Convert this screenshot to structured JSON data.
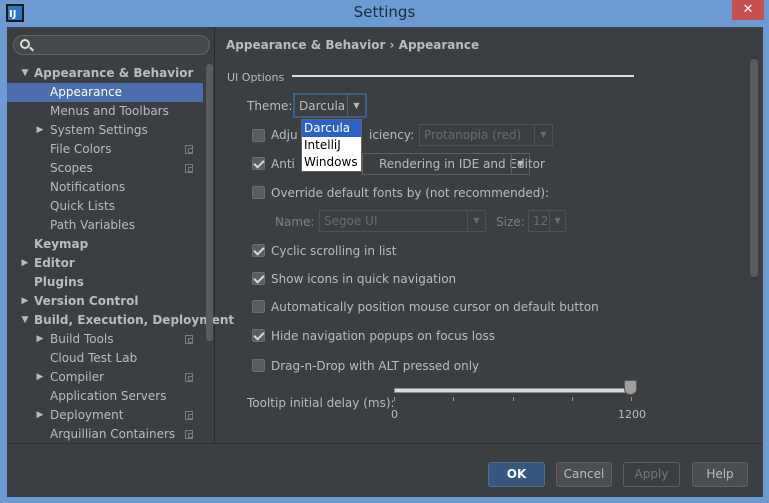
{
  "window": {
    "title": "Settings",
    "close_glyph": "✕",
    "app_icon": "intellij-icon"
  },
  "search": {
    "placeholder": ""
  },
  "sidebar": {
    "items": [
      {
        "label": "Appearance & Behavior",
        "expanded": true
      },
      {
        "label": "Appearance",
        "selected": true
      },
      {
        "label": "Menus and Toolbars"
      },
      {
        "label": "System Settings"
      },
      {
        "label": "File Colors"
      },
      {
        "label": "Scopes"
      },
      {
        "label": "Notifications"
      },
      {
        "label": "Quick Lists"
      },
      {
        "label": "Path Variables"
      },
      {
        "label": "Keymap"
      },
      {
        "label": "Editor"
      },
      {
        "label": "Plugins"
      },
      {
        "label": "Version Control"
      },
      {
        "label": "Build, Execution, Deployment",
        "expanded": true
      },
      {
        "label": "Build Tools"
      },
      {
        "label": "Cloud Test Lab"
      },
      {
        "label": "Compiler"
      },
      {
        "label": "Application Servers"
      },
      {
        "label": "Deployment"
      },
      {
        "label": "Arquillian Containers"
      }
    ]
  },
  "content": {
    "breadcrumb": "Appearance & Behavior › Appearance",
    "group_title": "UI Options",
    "theme_label": "Theme:",
    "theme_value": "Darcula",
    "theme_options": [
      "Darcula",
      "IntelliJ",
      "Windows"
    ],
    "adjust_label": "Adju",
    "adjust_label_tail": "iciency:",
    "deficiency_value": "Protanopia (red)",
    "antialias_label": "Anti",
    "antialias_value": "Rendering in IDE and Editor",
    "override_fonts_label": "Override default fonts by (not recommended):",
    "name_label": "Name:",
    "name_value": "Segoe UI",
    "size_label": "Size:",
    "size_value": "12",
    "cyclic_label": "Cyclic scrolling in list",
    "show_icons_label": "Show icons in quick navigation",
    "auto_cursor_label": "Automatically position mouse cursor on default button",
    "hide_popups_label": "Hide navigation popups on focus loss",
    "dnd_label": "Drag-n-Drop with ALT pressed only",
    "tooltip_label": "Tooltip initial delay (ms):",
    "tooltip_min": "0",
    "tooltip_max": "1200",
    "tooltip_value": 1200,
    "checks": {
      "adjust": false,
      "antialias": true,
      "override_fonts": false,
      "cyclic": true,
      "show_icons": true,
      "auto_cursor": false,
      "hide_popups": true,
      "dnd": false
    }
  },
  "buttons": {
    "ok": "OK",
    "cancel": "Cancel",
    "apply": "Apply",
    "help": "Help"
  },
  "colors": {
    "accent": "#4b6eaf",
    "background": "#3c3f41",
    "titlebar": "#6b9bd2",
    "close": "#c75050"
  }
}
